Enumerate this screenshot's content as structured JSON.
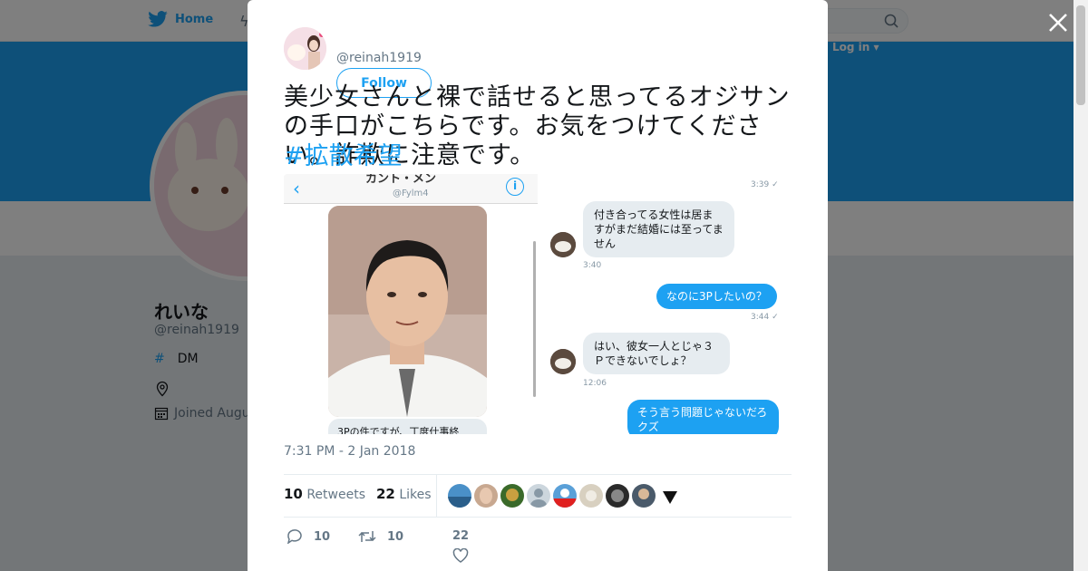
{
  "nav": {
    "home_label": "Home",
    "login_label": "Log in ▾"
  },
  "profile": {
    "name": "れいな",
    "handle": "@reinah1919",
    "bio_hashtag": "#",
    "bio_text": "DM",
    "joined": "Joined Augu"
  },
  "tweet": {
    "handle": "@reinah1919",
    "follow_label": "Follow",
    "text": "美少女さんと裸で話せると思ってるオジサンの手口がこちらです。お気をつけてください。詐欺に注意です。",
    "hashtag": "#拡散希望",
    "timestamp": "7:31 PM - 2 Jan 2018",
    "retweets_count": "10",
    "retweets_label": "Retweets",
    "likes_count": "22",
    "likes_label": "Likes",
    "reply_count": "10",
    "retweet_count": "10",
    "like_count": "22"
  },
  "media": {
    "left": {
      "name": "カント・メン",
      "id": "@Fylm4",
      "bubble": "3Pの件ですが、丁度仕事終"
    },
    "right": {
      "messages": [
        {
          "time": "3:39 ✓"
        },
        {
          "text": "付き合ってる女性は居ますがまだ結婚には至ってません",
          "time": "3:40"
        },
        {
          "text": "なのに3Pしたいの？",
          "time": "3:44 ✓"
        },
        {
          "text": "はい、彼女一人とじゃ３Ｐできないでしょ？",
          "time": "12:06"
        },
        {
          "text": "そう言う問題じゃないだろクズ"
        }
      ]
    }
  },
  "colors": {
    "accent": "#1da1f2",
    "text": "#14171a",
    "muted": "#657786"
  }
}
